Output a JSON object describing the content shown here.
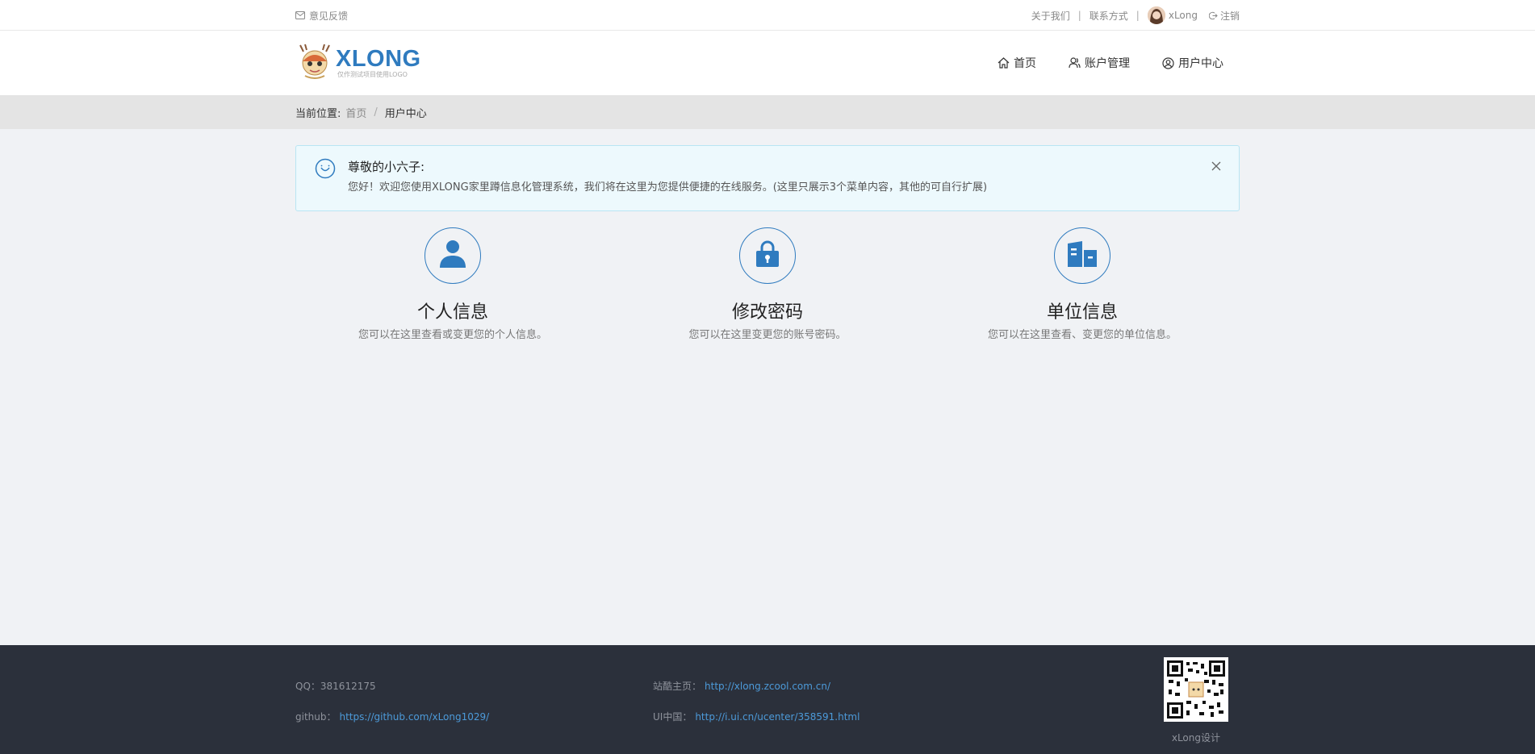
{
  "topbar": {
    "feedback": "意见反馈",
    "about": "关于我们",
    "contact": "联系方式",
    "separator": "|",
    "username": "xLong",
    "logout": "注销"
  },
  "header": {
    "logo_title": "XLONG",
    "logo_subtitle": "仅作测试项目使用LOGO",
    "nav": [
      {
        "label": "首页",
        "icon": "home-icon"
      },
      {
        "label": "账户管理",
        "icon": "users-icon"
      },
      {
        "label": "用户中心",
        "icon": "user-circle-icon"
      }
    ]
  },
  "breadcrumb": {
    "label": "当前位置:",
    "home": "首页",
    "separator": "/",
    "current": "用户中心"
  },
  "alert": {
    "title": "尊敬的小六子:",
    "body": "您好！欢迎您使用XLONG家里蹲信息化管理系统，我们将在这里为您提供便捷的在线服务。(这里只展示3个菜单内容，其他的可自行扩展)"
  },
  "cards": [
    {
      "title": "个人信息",
      "desc": "您可以在这里查看或变更您的个人信息。",
      "icon": "person-icon"
    },
    {
      "title": "修改密码",
      "desc": "您可以在这里变更您的账号密码。",
      "icon": "lock-icon"
    },
    {
      "title": "单位信息",
      "desc": "您可以在这里查看、变更您的单位信息。",
      "icon": "building-icon"
    }
  ],
  "footer": {
    "qq_label": "QQ：",
    "qq_value": "381612175",
    "github_label": "github：",
    "github_url": "https://github.com/xLong1029/",
    "zcool_label": "站酷主页：",
    "zcool_url": "http://xlong.zcool.com.cn/",
    "ui_label": "UI中国：",
    "ui_url": "http://i.ui.cn/ucenter/358591.html",
    "qr_caption": "xLong设计"
  },
  "colors": {
    "brand": "#2f7bbf",
    "link": "#4c9ad9",
    "footer_bg": "#2b303b",
    "page_bg": "#f0f2f5",
    "alert_bg": "#edf9fd"
  }
}
